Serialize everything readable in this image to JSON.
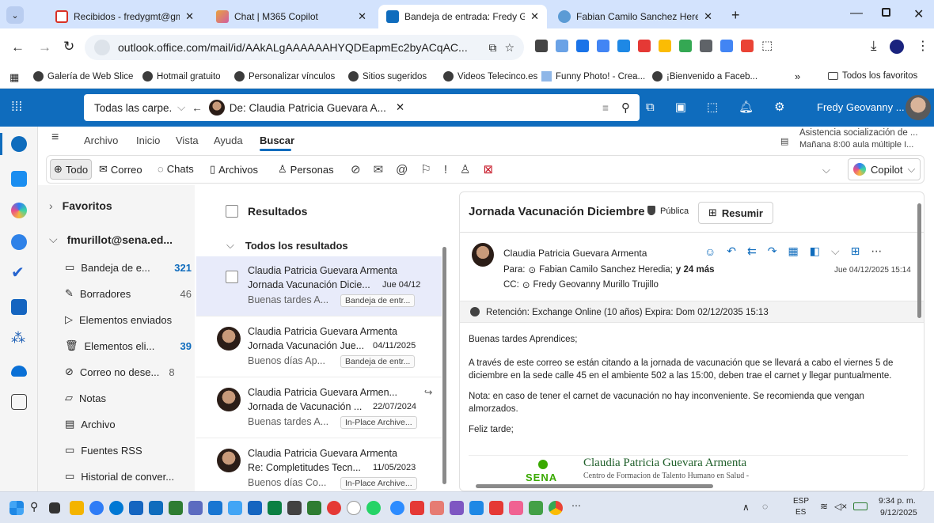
{
  "browser": {
    "tabs": [
      {
        "title": "Recibidos - fredygmt@gmail.co",
        "color": "#d93025"
      },
      {
        "title": "Chat | M365 Copilot",
        "color": "#e8a33d"
      },
      {
        "title": "Bandeja de entrada: Fredy Geo",
        "color": "#0f6cbd"
      },
      {
        "title": "Fabian Camilo Sanchez Heredia",
        "color": "#5b9bd5"
      }
    ],
    "url": "outlook.office.com/mail/id/AAkALgAAAAAAHYQDEapmEc2byACqAC...",
    "bookmarks": [
      "Galería de Web Slice",
      "Hotmail gratuito",
      "Personalizar vínculos",
      "Sitios sugeridos",
      "Videos Telecinco.es",
      "Funny Photo! - Crea...",
      "¡Bienvenido a Faceb..."
    ],
    "all_favorites": "Todos los favoritos"
  },
  "outlook": {
    "search_scope": "Todas las carpe...",
    "search_chip": "De: Claudia Patricia Guevara A...",
    "user": "Fredy Geovanny ...",
    "reminder_title": "Asistencia socialización de ...",
    "reminder_sub": "Mañana 8:00 aula múltiple I...",
    "ribbon_tabs": [
      "Archivo",
      "Inicio",
      "Vista",
      "Ayuda",
      "Buscar"
    ],
    "filters": [
      "Todo",
      "Correo",
      "Chats",
      "Archivos",
      "Personas"
    ],
    "copilot": "Copilot"
  },
  "folders": {
    "favoritos": "Favoritos",
    "account": "fmurillot@sena.ed...",
    "items": [
      {
        "name": "Bandeja de e...",
        "count": "321"
      },
      {
        "name": "Borradores",
        "count": "46"
      },
      {
        "name": "Elementos enviados",
        "count": ""
      },
      {
        "name": "Elementos eli...",
        "count": "39"
      },
      {
        "name": "Correo no dese...",
        "count": "8"
      },
      {
        "name": "Notas",
        "count": ""
      },
      {
        "name": "Archivo",
        "count": ""
      },
      {
        "name": "Fuentes RSS",
        "count": ""
      },
      {
        "name": "Historial de conver...",
        "count": ""
      }
    ]
  },
  "results": {
    "title": "Resultados",
    "group": "Todos los resultados",
    "messages": [
      {
        "from": "Claudia Patricia Guevara Armenta",
        "subject": "Jornada Vacunación Dicie...",
        "date": "Jue 04/12",
        "preview": "Buenas tardes A...",
        "folder": "Bandeja de entr..."
      },
      {
        "from": "Claudia Patricia Guevara Armenta",
        "subject": "Jornada Vacunación Jue...",
        "date": "04/11/2025",
        "preview": "Buenos días Ap...",
        "folder": "Bandeja de entr..."
      },
      {
        "from": "Claudia Patricia Guevara Armen...",
        "subject": "Jornada de Vacunación ...",
        "date": "22/07/2024",
        "preview": "Buenas tardes A...",
        "folder": "In-Place Archive..."
      },
      {
        "from": "Claudia Patricia Guevara Armenta",
        "subject": "Re: Completitudes Tecn...",
        "date": "11/05/2023",
        "preview": "Buenos días Co...",
        "folder": "In-Place Archive..."
      }
    ]
  },
  "reading": {
    "subject": "Jornada Vacunación Diciembre 5",
    "visibility": "Pública",
    "summarize": "Resumir",
    "sender": "Claudia Patricia Guevara Armenta",
    "to_label": "Para:",
    "to": "Fabian Camilo Sanchez Heredia;",
    "to_more": "y 24 más",
    "cc_label": "CC:",
    "cc": "Fredy Geovanny Murillo Trujillo",
    "datetime": "Jue 04/12/2025 15:14",
    "retention": "Retención: Exchange Online (10 años) Expira: Dom 02/12/2035 15:13",
    "greeting": "Buenas tardes Aprendices;",
    "p1": "A través de este correo se están citando a la jornada de vacunación que se llevará a cabo el viernes 5 de diciembre en la sede calle 45 en el ambiente 502 a las 15:00, deben trae el carnet y llegar puntualmente.",
    "p2": "Nota: en caso de tener el carnet de vacunación no hay inconveniente. Se recomienda que vengan almorzados.",
    "closing": "Feliz tarde;",
    "sig_name": "Claudia Patricia Guevara Armenta",
    "sig_sub": "Centro de Formacion de Talento Humano en Salud -",
    "sig_logo": "SENA"
  },
  "taskbar": {
    "lang1": "ESP",
    "lang2": "ES",
    "time": "9:34 p. m.",
    "date": "9/12/2025"
  }
}
